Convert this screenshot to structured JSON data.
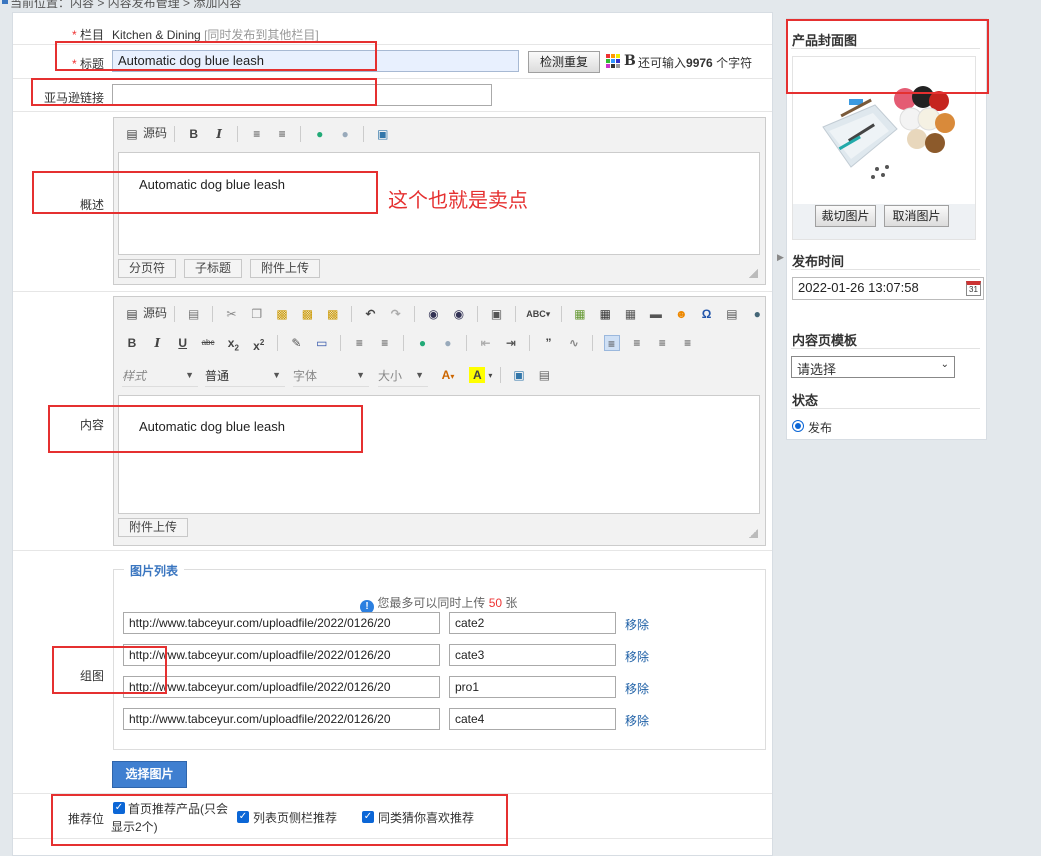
{
  "breadcrumb": "当前位置：内容 > 内容发布管理 > 添加内容",
  "form": {
    "category": {
      "label": "栏目",
      "value": "Kitchen & Dining",
      "hint": "[同时发布到其他栏目]"
    },
    "title": {
      "label": "标题",
      "value": "Automatic dog blue leash",
      "check_button": "检测重复",
      "bold_icon": "B",
      "remaining_prefix": "还可输入",
      "remaining_count": "9976",
      "remaining_suffix": "个字符"
    },
    "amazon_link": {
      "label": "亚马逊链接",
      "value": ""
    },
    "summary": {
      "label": "概述",
      "source_button": "源码",
      "content": "Automatic dog blue leash",
      "buttons": [
        "分页符",
        "子标题",
        "附件上传"
      ]
    },
    "content": {
      "label": "内容",
      "source_button": "源码",
      "style_select": "样式",
      "format_select": "普通",
      "font_select": "字体",
      "size_select": "大小",
      "content": "Automatic dog blue leash",
      "attach_button": "附件上传"
    },
    "gallery": {
      "label": "组图",
      "legend": "图片列表",
      "notice_prefix": "您最多可以同时上传",
      "notice_count": "50",
      "notice_suffix": "张",
      "remove_label": "移除",
      "rows": [
        {
          "url": "http://www.tabceyur.com/uploadfile/2022/0126/20",
          "name": "cate2"
        },
        {
          "url": "http://www.tabceyur.com/uploadfile/2022/0126/20",
          "name": "cate3"
        },
        {
          "url": "http://www.tabceyur.com/uploadfile/2022/0126/20",
          "name": "pro1"
        },
        {
          "url": "http://www.tabceyur.com/uploadfile/2022/0126/20",
          "name": "cate4"
        }
      ],
      "select_button": "选择图片"
    },
    "recommend": {
      "label": "推荐位",
      "options": [
        "首页推荐产品(只会",
        "显示2个)",
        "列表页侧栏推荐",
        "同类猜你喜欢推荐"
      ]
    }
  },
  "annotation": "这个也就是卖点",
  "sidebar": {
    "cover_title": "产品封面图",
    "crop_button": "裁切图片",
    "cancel_button": "取消图片",
    "publish_time_title": "发布时间",
    "publish_time": "2022-01-26 13:07:58",
    "template_title": "内容页模板",
    "template_select": "请选择",
    "status_title": "状态",
    "status_option": "发布"
  },
  "colors": {
    "accent": "#3a76c0",
    "annotation_red": "#e53030",
    "checkbox": "#0b66d6"
  }
}
